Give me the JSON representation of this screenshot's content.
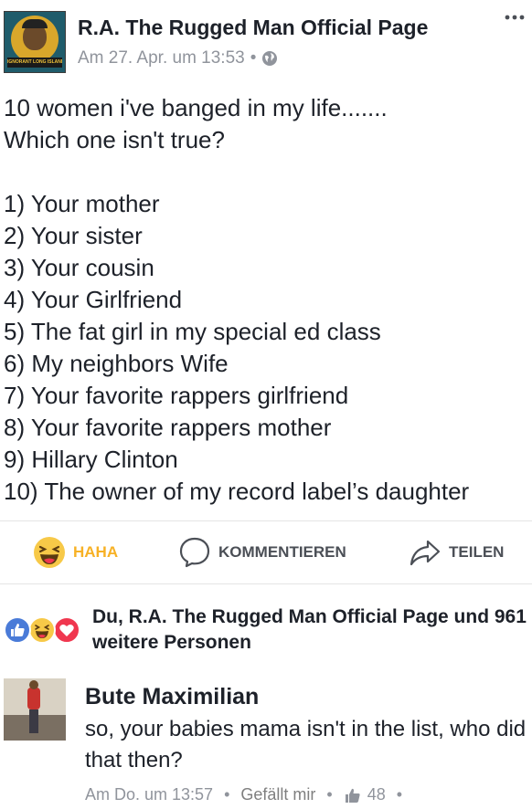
{
  "post": {
    "page_name": "R.A. The Rugged Man Official Page",
    "avatar_banner_text": "IGNORANT LONG ISLAND GUY'S",
    "timestamp": "Am 27. Apr. um 13:53",
    "meta_separator": "•",
    "privacy_icon": "globe-icon",
    "more_icon": "more-dots-icon",
    "body_lines": [
      "10 women i've banged in my life.......",
      "Which one isn't true?",
      "",
      "1) Your mother",
      "2) Your sister",
      "3) Your cousin",
      "4) Your Girlfriend",
      "5) The fat girl in my special ed class",
      "6) My neighbors Wife",
      "7) Your favorite rappers girlfriend",
      "8) Your favorite rappers mother",
      "9) Hillary Clinton",
      "10) The owner of my record label’s daughter"
    ]
  },
  "actions": {
    "haha_label": "HAHA",
    "comment_label": "KOMMENTIEREN",
    "share_label": "TEILEN",
    "haha_color": "#f7b125"
  },
  "reactions": {
    "icons": [
      "like-reaction-icon",
      "haha-reaction-icon",
      "love-reaction-icon"
    ],
    "summary": "Du, R.A. The Rugged Man Official Page und 961 weitere Personen"
  },
  "comment": {
    "author": "Bute Maximilian",
    "text": "so, your babies mama isn't in the list, who did that then?",
    "timestamp": "Am Do. um 13:57",
    "separator": "•",
    "like_link": "Gefällt mir",
    "like_count": "48"
  },
  "colors": {
    "text_primary": "#1d2129",
    "text_secondary": "#90949c",
    "like_blue": "#4a7bd8",
    "love_red": "#f0374f",
    "haha_yellow": "#f7c948"
  }
}
